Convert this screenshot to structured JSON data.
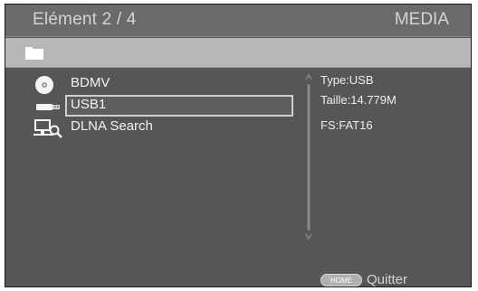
{
  "header": {
    "title": "Elément 2 / 4",
    "source_label": "MEDIA"
  },
  "toolbar": {
    "icon": "folder-icon"
  },
  "items": [
    {
      "label": "BDMV",
      "icon": "disc-icon",
      "selected": false
    },
    {
      "label": "USB1",
      "icon": "usb-icon",
      "selected": true
    },
    {
      "label": "DLNA Search",
      "icon": "network-search-icon",
      "selected": false
    }
  ],
  "info": {
    "type": "Type:USB",
    "size": "Taille:14.779M",
    "fs": "FS:FAT16"
  },
  "footer": {
    "home_button_label": "HOME",
    "quit_label": "Quitter"
  },
  "colors": {
    "background": "#565656",
    "titlebar": "#6a6a6a",
    "folderbar": "#b7b7b7",
    "text": "#f2f2f2"
  }
}
